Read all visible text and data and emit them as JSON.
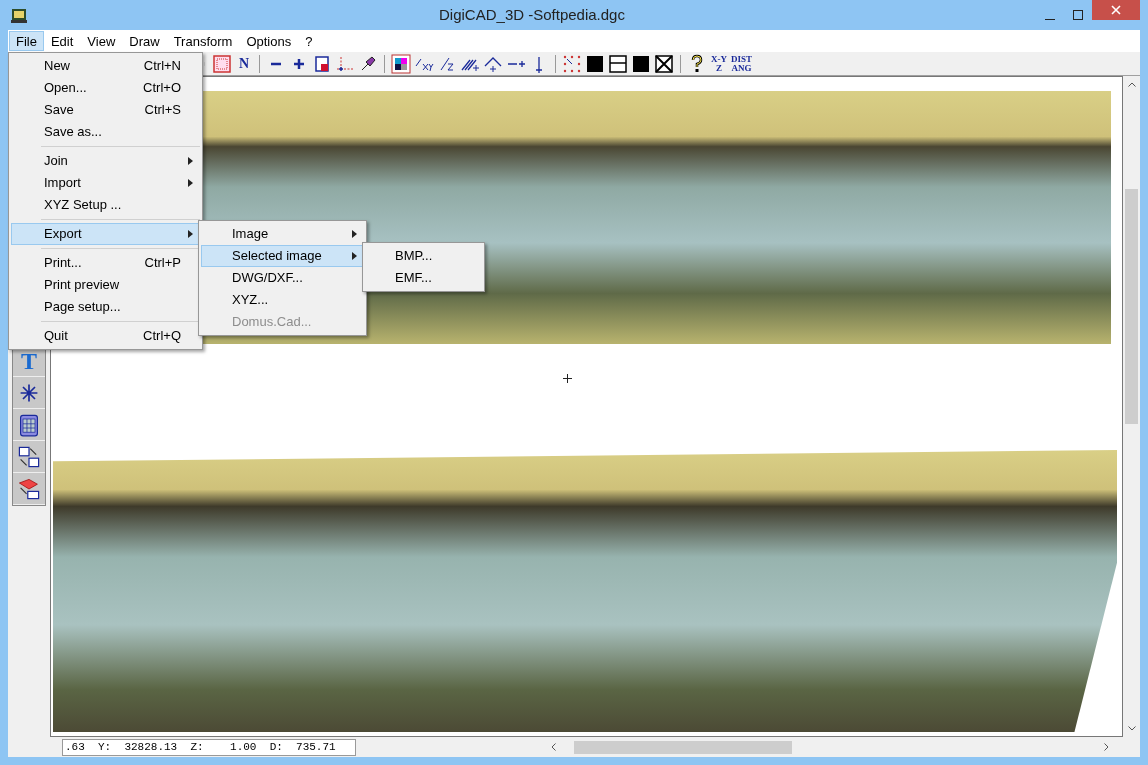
{
  "window": {
    "title": "DigiCAD_3D -Softpedia.dgc"
  },
  "menubar": [
    {
      "label": "File",
      "selected": true
    },
    {
      "label": "Edit",
      "selected": false
    },
    {
      "label": "View",
      "selected": false
    },
    {
      "label": "Draw",
      "selected": false
    },
    {
      "label": "Transform",
      "selected": false
    },
    {
      "label": "Options",
      "selected": false
    },
    {
      "label": "?",
      "selected": false
    }
  ],
  "toolbar": [
    {
      "kind": "partial"
    },
    {
      "kind": "dotrect"
    },
    {
      "kind": "text",
      "label": "N"
    },
    {
      "kind": "sep"
    },
    {
      "kind": "minus"
    },
    {
      "kind": "plus"
    },
    {
      "kind": "page"
    },
    {
      "kind": "axis"
    },
    {
      "kind": "brush"
    },
    {
      "kind": "sep"
    },
    {
      "kind": "palette"
    },
    {
      "kind": "xy"
    },
    {
      "kind": "z"
    },
    {
      "kind": "parallel"
    },
    {
      "kind": "angle"
    },
    {
      "kind": "dashplus"
    },
    {
      "kind": "down"
    },
    {
      "kind": "sep"
    },
    {
      "kind": "dots"
    },
    {
      "kind": "black"
    },
    {
      "kind": "lines"
    },
    {
      "kind": "black"
    },
    {
      "kind": "xbox"
    },
    {
      "kind": "sep"
    },
    {
      "kind": "help"
    },
    {
      "kind": "text",
      "label": "X-Y\nZ"
    },
    {
      "kind": "text",
      "label": "DIST\nANG"
    }
  ],
  "side_toolbar": [
    {
      "kind": "text",
      "label": "T"
    },
    {
      "kind": "star"
    },
    {
      "kind": "calc"
    },
    {
      "kind": "convert"
    },
    {
      "kind": "mesh"
    }
  ],
  "file_menu": [
    {
      "kind": "item",
      "label": "New",
      "shortcut": "Ctrl+N",
      "selected": false,
      "submenu": false
    },
    {
      "kind": "item",
      "label": "Open...",
      "shortcut": "Ctrl+O",
      "selected": false,
      "submenu": false
    },
    {
      "kind": "item",
      "label": "Save",
      "shortcut": "Ctrl+S",
      "selected": false,
      "submenu": false
    },
    {
      "kind": "item",
      "label": "Save as...",
      "selected": false,
      "submenu": false
    },
    {
      "kind": "sep"
    },
    {
      "kind": "item",
      "label": "Join",
      "selected": false,
      "submenu": true
    },
    {
      "kind": "item",
      "label": "Import",
      "selected": false,
      "submenu": true
    },
    {
      "kind": "item",
      "label": "XYZ Setup ...",
      "selected": false,
      "submenu": false
    },
    {
      "kind": "sep"
    },
    {
      "kind": "item",
      "label": "Export",
      "selected": true,
      "submenu": true
    },
    {
      "kind": "sep"
    },
    {
      "kind": "item",
      "label": "Print...",
      "shortcut": "Ctrl+P",
      "selected": false,
      "submenu": false
    },
    {
      "kind": "item",
      "label": "Print preview",
      "selected": false,
      "submenu": false
    },
    {
      "kind": "item",
      "label": "Page setup...",
      "selected": false,
      "submenu": false
    },
    {
      "kind": "sep"
    },
    {
      "kind": "item",
      "label": "Quit",
      "shortcut": "Ctrl+Q",
      "selected": false,
      "submenu": false
    }
  ],
  "export_menu": [
    {
      "label": "Image",
      "selected": false,
      "submenu": true,
      "disabled": false
    },
    {
      "label": "Selected image",
      "selected": true,
      "submenu": true,
      "disabled": false
    },
    {
      "label": "DWG/DXF...",
      "selected": false,
      "submenu": false,
      "disabled": false
    },
    {
      "label": "XYZ...",
      "selected": false,
      "submenu": false,
      "disabled": false
    },
    {
      "label": "Domus.Cad...",
      "selected": false,
      "submenu": false,
      "disabled": true
    }
  ],
  "selected_image_menu": [
    {
      "label": "BMP..."
    },
    {
      "label": "EMF..."
    }
  ],
  "status_bar": {
    "coordinates": ".63  Y:  32828.13  Z:    1.00  D:  735.71"
  }
}
